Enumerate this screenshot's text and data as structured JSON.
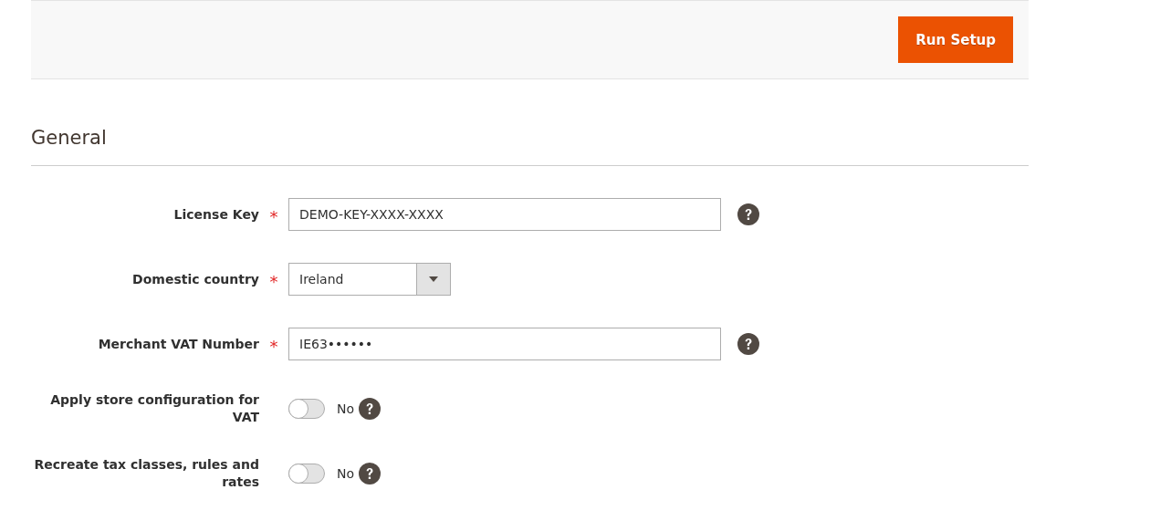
{
  "header": {
    "button": "Run Setup"
  },
  "section": {
    "title": "General"
  },
  "fields": [
    {
      "kind": "text",
      "label": "License Key",
      "required_mark": "*",
      "value": "DEMO-KEY-XXXX-XXXX",
      "help": true
    },
    {
      "kind": "select",
      "label": "Domestic country",
      "required_mark": "*",
      "value": "Ireland",
      "help": false
    },
    {
      "kind": "text",
      "label": "Merchant VAT Number",
      "required_mark": "*",
      "value": "IE63••••••",
      "help": true
    },
    {
      "kind": "toggle",
      "label": "Apply store configuration for VAT",
      "on": false,
      "value": "No",
      "help": true
    },
    {
      "kind": "toggle",
      "label": "Recreate tax classes, rules and rates",
      "on": false,
      "value": "No",
      "help": true
    }
  ]
}
